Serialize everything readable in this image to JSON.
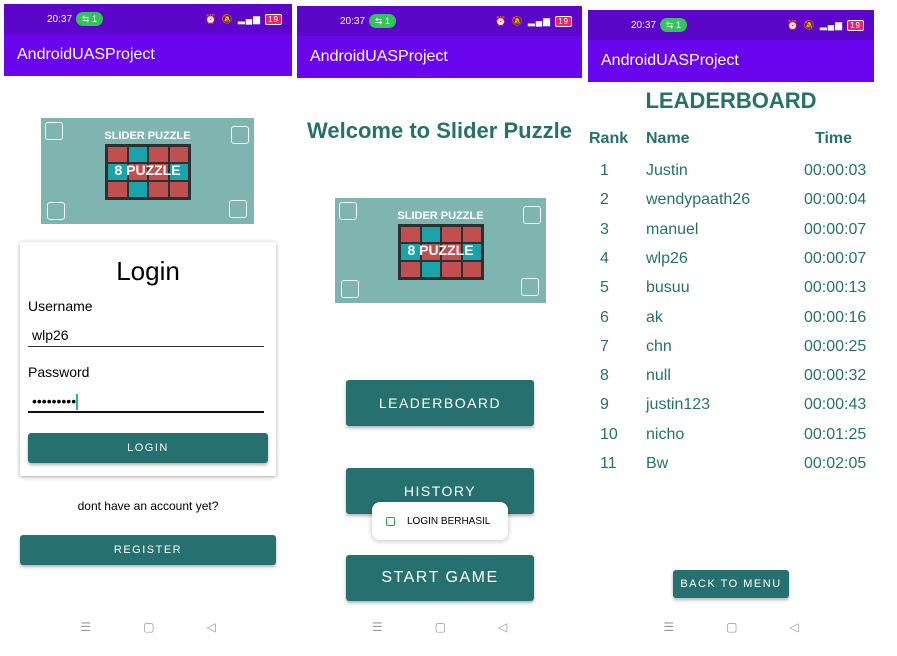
{
  "status": {
    "time": "20:37",
    "hotspot": "1",
    "battery": "19"
  },
  "app": {
    "title": "AndroidUASProject"
  },
  "logo": {
    "title": "SLIDER PUZZLE",
    "label": "8 PUZZLE"
  },
  "login": {
    "heading": "Login",
    "username_label": "Username",
    "username_value": "wlp26",
    "password_label": "Password",
    "password_value": "•••••••••",
    "login_button": "LOGIN",
    "no_account_text": "dont have an account yet?",
    "register_button": "REGISTER"
  },
  "menu": {
    "welcome": "Welcome to Slider Puzzle",
    "leaderboard_button": "LEADERBOARD",
    "history_button": "HISTORY",
    "start_button": "START GAME",
    "toast": "LOGIN BERHASIL"
  },
  "leaderboard": {
    "title": "LEADERBOARD",
    "columns": [
      "Rank",
      "Name",
      "Time"
    ],
    "rows": [
      {
        "rank": "1",
        "name": "Justin",
        "time": "00:00:03"
      },
      {
        "rank": "2",
        "name": "wendypaath26",
        "time": "00:00:04"
      },
      {
        "rank": "3",
        "name": "manuel",
        "time": "00:00:07"
      },
      {
        "rank": "4",
        "name": "wlp26",
        "time": "00:00:07"
      },
      {
        "rank": "5",
        "name": "busuu",
        "time": "00:00:13"
      },
      {
        "rank": "6",
        "name": "ak",
        "time": "00:00:16"
      },
      {
        "rank": "7",
        "name": "chn",
        "time": "00:00:25"
      },
      {
        "rank": "8",
        "name": "null",
        "time": "00:00:32"
      },
      {
        "rank": "9",
        "name": "justin123",
        "time": "00:00:43"
      },
      {
        "rank": "10",
        "name": "nicho",
        "time": "00:01:25"
      },
      {
        "rank": "11",
        "name": "Bw",
        "time": "00:02:05"
      }
    ],
    "back_button": "BACK TO MENU"
  },
  "colors": {
    "statusbar": "#5b06c9",
    "appbar": "#6a06ee",
    "accent": "#26716f",
    "logo_bg": "#7fb5b1"
  },
  "icons": {
    "nav": [
      "menu-icon",
      "home-icon",
      "back-icon"
    ]
  }
}
